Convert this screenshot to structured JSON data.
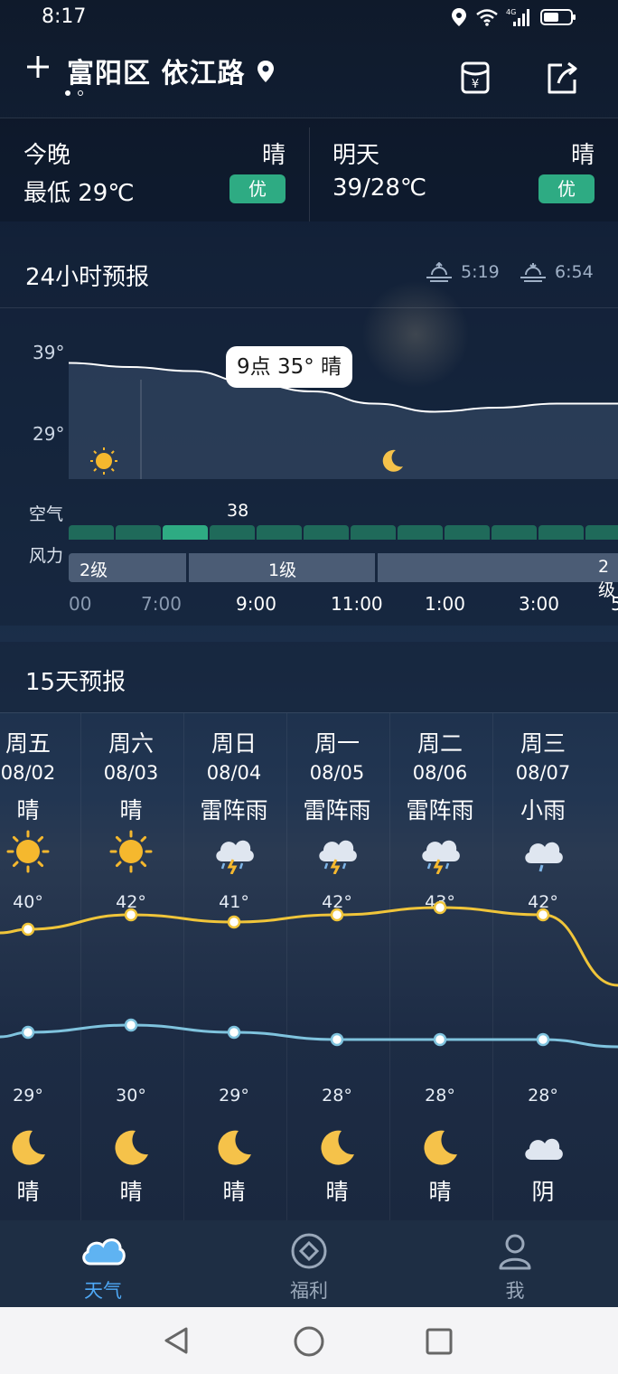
{
  "status_bar": {
    "time": "8:17"
  },
  "header": {
    "title": "富阳区 依江路",
    "colors": {
      "accent": "#2eab83"
    }
  },
  "today": [
    {
      "period": "今晚",
      "condition": "晴",
      "temp": "最低 29℃",
      "aqi": "优"
    },
    {
      "period": "明天",
      "condition": "晴",
      "temp": "39/28℃",
      "aqi": "优"
    }
  ],
  "hourly": {
    "title": "24小时预报",
    "sunrise": "5:19",
    "sunset": "6:54",
    "y_max_label": "39°",
    "y_min_label": "29°",
    "tooltip": "9点 35° 晴",
    "air_label": "空气",
    "air_value": "38",
    "wind_label": "风力",
    "wind_segments": [
      "2级",
      "1级",
      "2级"
    ],
    "times": [
      "00",
      "7:00",
      "9:00",
      "11:00",
      "1:00",
      "3:00",
      "5"
    ],
    "chart_data": {
      "type": "area",
      "ylim": [
        29,
        39
      ],
      "series": [
        {
          "values": [
            37.5,
            37,
            36.5,
            35,
            34,
            32.5,
            31.5,
            32,
            32.5,
            32.5
          ]
        }
      ]
    }
  },
  "daily": {
    "title": "15天预报",
    "days": [
      {
        "weekday": "周五",
        "date": "08/02",
        "day_cond": "晴",
        "day_icon": "sun-icon",
        "high": "40°",
        "low": "29°",
        "night_icon": "moon-icon",
        "night_cond": "晴",
        "high_value": 40,
        "low_value": 29
      },
      {
        "weekday": "周六",
        "date": "08/03",
        "day_cond": "晴",
        "day_icon": "sun-icon",
        "high": "42°",
        "low": "30°",
        "night_icon": "moon-icon",
        "night_cond": "晴",
        "high_value": 42,
        "low_value": 30
      },
      {
        "weekday": "周日",
        "date": "08/04",
        "day_cond": "雷阵雨",
        "day_icon": "thunderstorm-icon",
        "high": "41°",
        "low": "29°",
        "night_icon": "moon-icon",
        "night_cond": "晴",
        "high_value": 41,
        "low_value": 29
      },
      {
        "weekday": "周一",
        "date": "08/05",
        "day_cond": "雷阵雨",
        "day_icon": "thunderstorm-icon",
        "high": "42°",
        "low": "28°",
        "night_icon": "moon-icon",
        "night_cond": "晴",
        "high_value": 42,
        "low_value": 28
      },
      {
        "weekday": "周二",
        "date": "08/06",
        "day_cond": "雷阵雨",
        "day_icon": "thunderstorm-icon",
        "high": "43°",
        "low": "28°",
        "night_icon": "moon-icon",
        "night_cond": "晴",
        "high_value": 43,
        "low_value": 28
      },
      {
        "weekday": "周三",
        "date": "08/07",
        "day_cond": "小雨",
        "day_icon": "rain-cloud-icon",
        "high": "42°",
        "low": "28°",
        "night_icon": "cloud-icon",
        "night_cond": "阴",
        "high_value": 42,
        "low_value": 28
      }
    ]
  },
  "nav": [
    {
      "label": "天气",
      "icon": "cloud-icon",
      "active": true
    },
    {
      "label": "福利",
      "icon": "diamond-coin-icon",
      "active": false
    },
    {
      "label": "我",
      "icon": "person-icon",
      "active": false
    }
  ]
}
